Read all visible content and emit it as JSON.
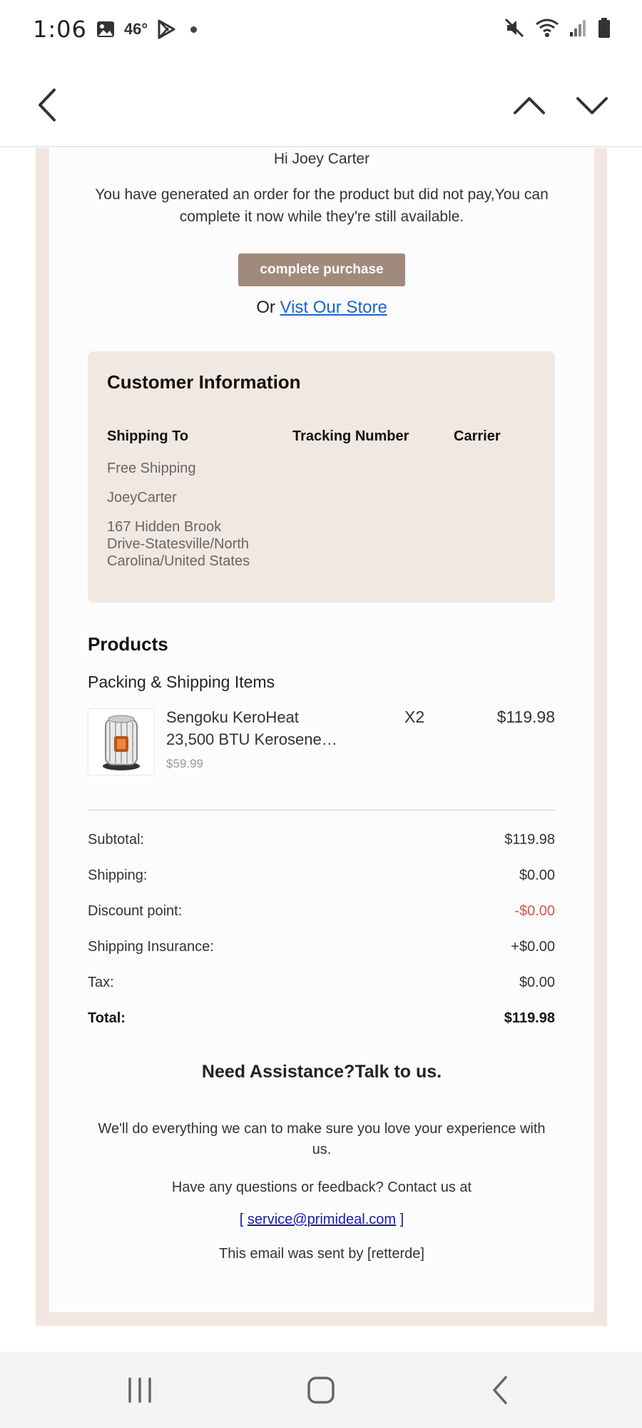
{
  "status_bar": {
    "time": "1:06",
    "temperature": "46°",
    "icons": [
      "gallery-icon",
      "play-store-icon",
      "mute-icon",
      "wifi-icon",
      "signal-icon",
      "battery-icon"
    ]
  },
  "nav": {
    "icons": [
      "back-chevron-icon",
      "chevron-up-icon",
      "chevron-down-icon"
    ]
  },
  "email": {
    "greeting": "Hi Joey Carter",
    "intro": "You have generated an order for the product but did not pay,You can complete it now while they're still available.",
    "cta_label": "complete purchase",
    "store_prefix": "Or ",
    "store_link": "Vist Our Store",
    "customer_info": {
      "title": "Customer Information",
      "headers": [
        "Shipping To",
        "Tracking Number",
        "Carrier"
      ],
      "shipping_method": "Free Shipping",
      "name": "JoeyCarter",
      "address_lines": [
        "167 Hidden Brook",
        "Drive-Statesville/North",
        "Carolina/United States"
      ]
    },
    "products_title": "Products",
    "packing_title": "Packing & Shipping Items",
    "product": {
      "name": "Sengoku KeroHeat 23,500 BTU Kerosene…",
      "unit_price": "$59.99",
      "qty": "X2",
      "price": "$119.98"
    },
    "summary": [
      {
        "label": "Subtotal:",
        "value": "$119.98"
      },
      {
        "label": "Shipping:",
        "value": "$0.00"
      },
      {
        "label": "Discount point:",
        "value": "-$0.00"
      },
      {
        "label": "Shipping Insurance:",
        "value": "+$0.00"
      },
      {
        "label": "Tax:",
        "value": "$0.00"
      },
      {
        "label": "Total:",
        "value": "$119.98"
      }
    ],
    "assist_title": "Need Assistance?Talk to us.",
    "assist_text": "We'll do everything we can to make sure you love your experience with us.",
    "contact_line": "Have any questions or feedback? Contact us at",
    "contact_email": "service@primideal.com",
    "bracket_open": "[ ",
    "bracket_close": " ]",
    "sent_by": "This email was sent by [retterde]"
  },
  "colors": {
    "cta": "#a08a7c",
    "frame": "#f3e6e0",
    "card": "#f1e8e2",
    "link": "#1a66c9",
    "negative": "#d9534f"
  }
}
